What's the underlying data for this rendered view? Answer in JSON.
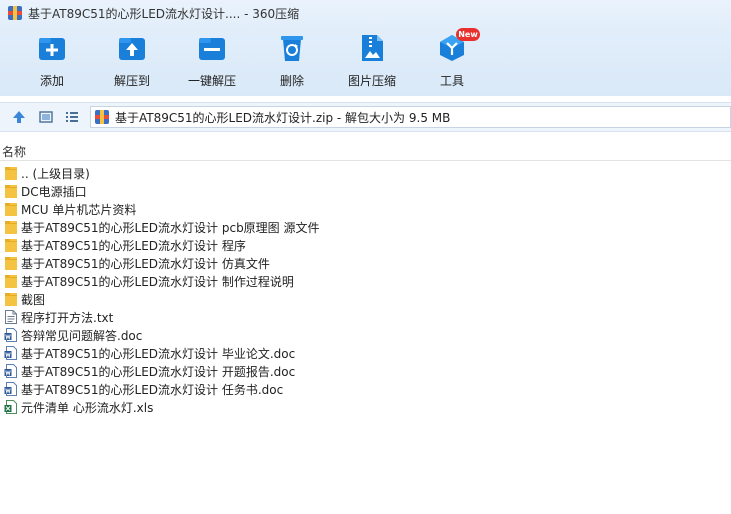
{
  "window": {
    "title": "基于AT89C51的心形LED流水灯设计.... - 360压缩"
  },
  "toolbar": {
    "items": [
      {
        "id": "add",
        "label": "添加",
        "icon": "add-icon"
      },
      {
        "id": "extract",
        "label": "解压到",
        "icon": "extract-to-icon"
      },
      {
        "id": "oneclick",
        "label": "一键解压",
        "icon": "one-click-extract-icon"
      },
      {
        "id": "delete",
        "label": "删除",
        "icon": "recycle-delete-icon"
      },
      {
        "id": "image",
        "label": "图片压缩",
        "icon": "image-compress-icon"
      },
      {
        "id": "tools",
        "label": "工具",
        "icon": "tools-icon"
      }
    ],
    "new_badge": "New"
  },
  "address": {
    "path": "基于AT89C51的心形LED流水灯设计.zip - 解包大小为 9.5 MB"
  },
  "columns": {
    "name": "名称"
  },
  "files": [
    {
      "name": ".. (上级目录)",
      "type": "folder"
    },
    {
      "name": "DC电源插口",
      "type": "folder"
    },
    {
      "name": "MCU 单片机芯片资料",
      "type": "folder"
    },
    {
      "name": "基于AT89C51的心形LED流水灯设计 pcb原理图 源文件",
      "type": "folder"
    },
    {
      "name": "基于AT89C51的心形LED流水灯设计 程序",
      "type": "folder"
    },
    {
      "name": "基于AT89C51的心形LED流水灯设计 仿真文件",
      "type": "folder"
    },
    {
      "name": "基于AT89C51的心形LED流水灯设计 制作过程说明",
      "type": "folder"
    },
    {
      "name": "截图",
      "type": "folder"
    },
    {
      "name": "程序打开方法.txt",
      "type": "txt"
    },
    {
      "name": "答辩常见问题解答.doc",
      "type": "doc"
    },
    {
      "name": "基于AT89C51的心形LED流水灯设计 毕业论文.doc",
      "type": "doc"
    },
    {
      "name": "基于AT89C51的心形LED流水灯设计 开题报告.doc",
      "type": "doc"
    },
    {
      "name": "基于AT89C51的心形LED流水灯设计 任务书.doc",
      "type": "doc"
    },
    {
      "name": "元件清单  心形流水灯.xls",
      "type": "xls"
    }
  ],
  "colors": {
    "accent": "#1a7fd8",
    "folder": "#f5c342",
    "badge": "#e8302f"
  }
}
